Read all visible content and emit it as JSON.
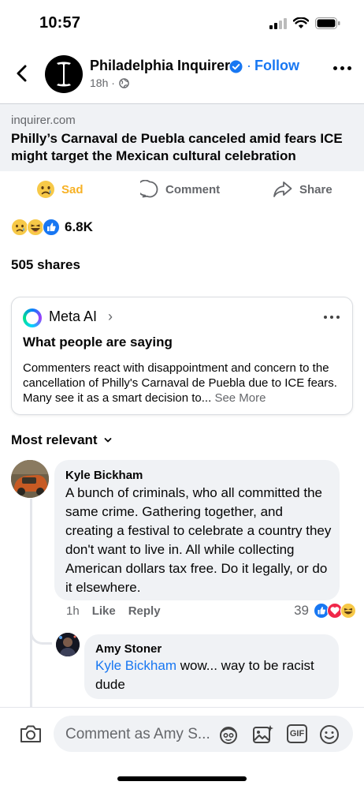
{
  "status_bar": {
    "time": "10:57"
  },
  "header": {
    "page_name": "Philadelphia Inquirer",
    "follow_label": "Follow",
    "separator": "·",
    "post_age": "18h ·"
  },
  "link_preview": {
    "domain": "inquirer.com",
    "title": "Philly’s Carnaval de Puebla canceled amid fears ICE might target the Mexican cultural celebration"
  },
  "actions": {
    "sad_label": "Sad",
    "comment_label": "Comment",
    "share_label": "Share"
  },
  "reactions": {
    "count": "6.8K",
    "icons": [
      "sad-emoji",
      "haha-emoji",
      "like-thumb"
    ]
  },
  "shares": "505 shares",
  "meta_ai": {
    "title": "Meta AI",
    "chevron": "›",
    "heading": "What people are saying",
    "summary": "Commenters react with disappointment and concern to the cancellation of Philly's Carnaval de Puebla due to ICE fears. Many see it as a smart decision to...",
    "see_more": "See More"
  },
  "comments": {
    "sort_label": "Most relevant",
    "items": [
      {
        "author": "Kyle Bickham",
        "text": "A bunch of criminals, who all committed the same crime. Gathering together, and creating a festival to celebrate a country they don't want to live in. All while collecting American dollars tax free. Do it legally, or do it elsewhere.",
        "time": "1h",
        "like_label": "Like",
        "reply_label": "Reply",
        "reaction_count": "39",
        "reaction_icons": [
          "like-thumb",
          "love-heart",
          "haha-emoji"
        ]
      }
    ],
    "replies": [
      {
        "author": "Amy Stoner",
        "mention": "Kyle Bickham",
        "text": " wow... way to be racist dude"
      }
    ]
  },
  "composer": {
    "placeholder": "Comment as Amy S...",
    "gif_label": "GIF"
  },
  "colors": {
    "accent": "#1877f2",
    "secondary_text": "#65676b",
    "sad_yellow": "#f7b125",
    "bubble_bg": "#f0f2f5"
  }
}
